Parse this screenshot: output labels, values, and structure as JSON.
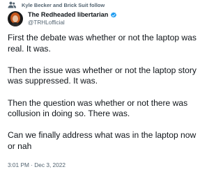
{
  "social_context": {
    "icon": "people-follow-icon",
    "text": "Kyle Becker and Brick Suit follow"
  },
  "author": {
    "display_name": "The Redheaded libertarian",
    "handle": "@TRHLofficial",
    "verified_icon": "verified-badge-icon",
    "verified_color": "#1d9bf0"
  },
  "tweet": {
    "paragraphs": [
      "First the debate was whether or not the laptop was real. It was.",
      "Then the issue was whether or not the laptop story was suppressed. It was.",
      "Then the question was whether or not there was collusion in doing so. There was.",
      "Can we finally address what was in the laptop now or nah"
    ],
    "timestamp": "3:01 PM · Dec 3, 2022"
  },
  "colors": {
    "text_primary": "#0f1419",
    "text_secondary": "#536471",
    "avatar_background": "#1a1a1a",
    "avatar_hair": "#c4581e"
  }
}
